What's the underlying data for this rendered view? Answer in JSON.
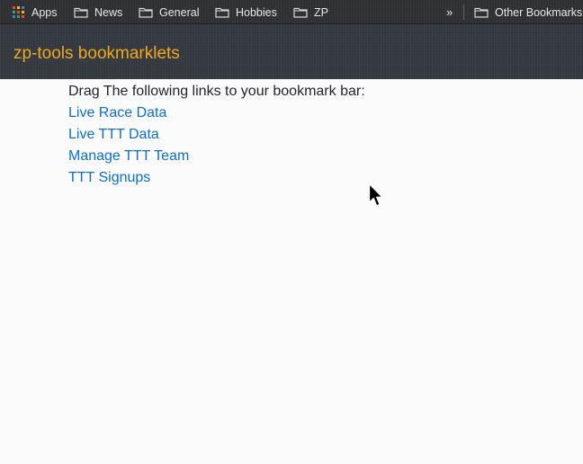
{
  "bookmarks_bar": {
    "items": [
      {
        "label": "Apps",
        "icon": "apps-grid-icon"
      },
      {
        "label": "News",
        "icon": "folder-icon"
      },
      {
        "label": "General",
        "icon": "folder-icon"
      },
      {
        "label": "Hobbies",
        "icon": "folder-icon"
      },
      {
        "label": "ZP",
        "icon": "folder-icon"
      }
    ],
    "overflow_label": "»",
    "other_bookmarks_label": "Other Bookmarks"
  },
  "navbar": {
    "brand": "zp-tools bookmarklets"
  },
  "main": {
    "intro": "Drag The following links to your bookmark bar:",
    "links": [
      {
        "label": "Live Race Data"
      },
      {
        "label": "Live TTT Data"
      },
      {
        "label": "Manage TTT Team"
      },
      {
        "label": "TTT Signups"
      }
    ]
  },
  "colors": {
    "navbar_bg": "#343a40",
    "brand": "#f0a81e",
    "link": "#0a6fd6",
    "page_bg": "#fbfbfb"
  }
}
